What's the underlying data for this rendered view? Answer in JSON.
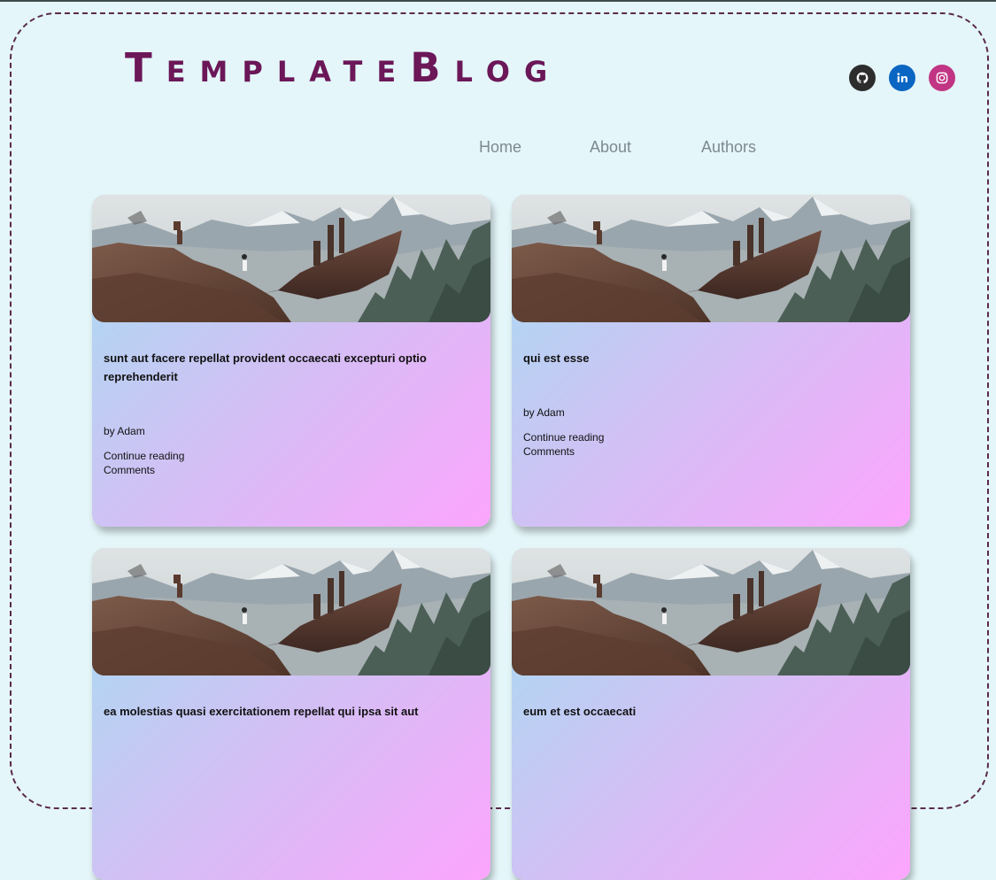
{
  "header": {
    "logo": "TemplateBlog"
  },
  "social": {
    "github_icon": "github-icon",
    "linkedin_icon": "linkedin-icon",
    "instagram_icon": "instagram-icon",
    "colors": {
      "github": "#2d2d2d",
      "linkedin": "#0a66c2",
      "instagram": "#c13584"
    }
  },
  "nav": {
    "home": "Home",
    "about": "About",
    "authors": "Authors"
  },
  "posts": [
    {
      "title": "sunt aut facere repellat provident occaecati excepturi optio reprehenderit",
      "author": "by Adam",
      "continue": "Continue reading",
      "comments": "Comments"
    },
    {
      "title": "qui est esse",
      "author": "by Adam",
      "continue": "Continue reading",
      "comments": "Comments"
    },
    {
      "title": "ea molestias quasi exercitationem repellat qui ipsa sit aut",
      "author": "",
      "continue": "",
      "comments": ""
    },
    {
      "title": "eum et est occaecati",
      "author": "",
      "continue": "",
      "comments": ""
    }
  ],
  "colors": {
    "background": "#e4f6f9",
    "logo": "#6b1758",
    "nav": "#7e8891",
    "card_gradient_start": "#a5def2",
    "card_gradient_end": "#fca5fd"
  }
}
